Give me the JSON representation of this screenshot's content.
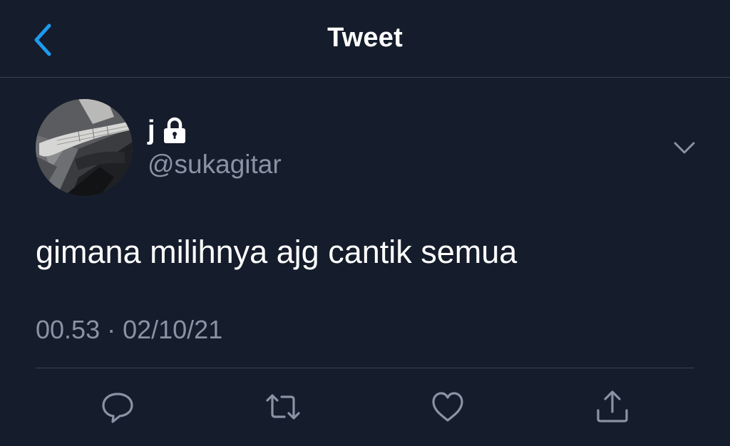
{
  "nav": {
    "title": "Tweet",
    "back_icon": "chevron-left-icon"
  },
  "author": {
    "display_name": "j",
    "handle": "@sukagitar",
    "protected_icon": "lock-icon"
  },
  "tweet": {
    "text": "gimana milihnya ajg cantik semua",
    "timestamp": "00.53 · 02/10/21"
  },
  "actions": {
    "icons": [
      "reply-icon",
      "retweet-icon",
      "like-icon",
      "share-icon"
    ]
  },
  "colors": {
    "background": "#151c2b",
    "accent": "#1d9bf0",
    "secondary_text": "#8a93a3",
    "divider": "#3b4455"
  }
}
